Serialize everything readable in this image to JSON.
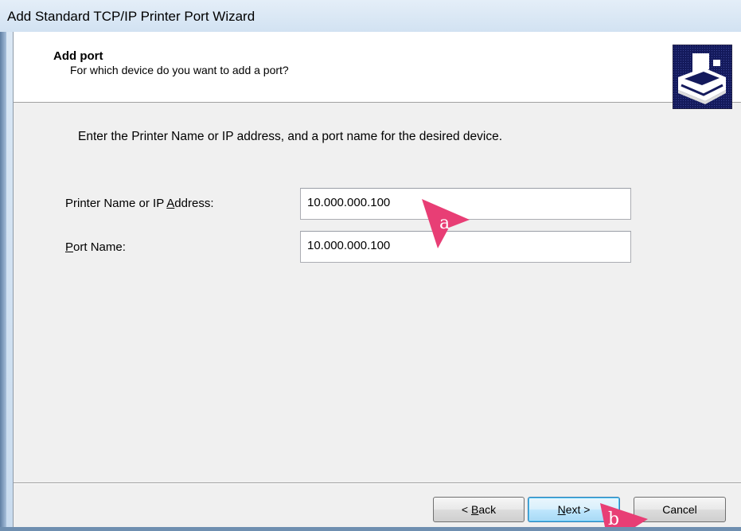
{
  "window": {
    "title": "Add Standard TCP/IP Printer Port Wizard"
  },
  "header": {
    "title": "Add port",
    "subtitle": "For which device do you want to add a port?",
    "icon": "printer-port-icon"
  },
  "body": {
    "instructions": "Enter the Printer Name or IP address, and a port name for the desired device."
  },
  "fields": {
    "printer_name": {
      "label_before": "Printer Name or IP ",
      "label_accel": "A",
      "label_after": "ddress:",
      "value": "10.000.000.100"
    },
    "port_name": {
      "label_accel": "P",
      "label_after": "ort Name:",
      "value": "10.000.000.100"
    }
  },
  "buttons": {
    "back": {
      "prefix": "< ",
      "accel": "B",
      "rest": "ack"
    },
    "next": {
      "accel": "N",
      "rest": "ext >"
    },
    "cancel": {
      "label": "Cancel"
    }
  },
  "annotations": {
    "marker_a": "a",
    "marker_b": "b",
    "color": "#e83e75"
  }
}
